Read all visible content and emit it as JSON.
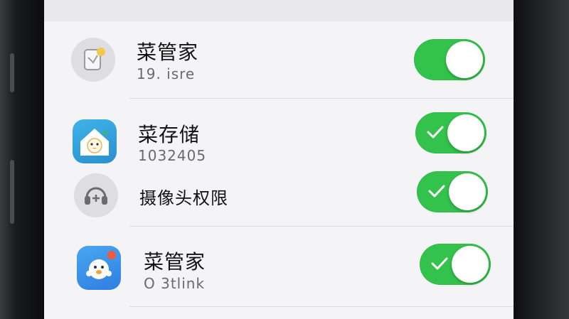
{
  "rows": [
    {
      "title": "菜管家",
      "subtitle": "19. isre",
      "icon": "cleaner-app-icon",
      "toggle_on": true,
      "show_check": false
    },
    {
      "title": "菜存储",
      "subtitle": "1032405",
      "icon": "storage-app-icon",
      "toggle_on": true,
      "show_check": true
    },
    {
      "title": "摄像头权限",
      "subtitle": "",
      "icon": "headset-icon",
      "toggle_on": true,
      "show_check": true
    },
    {
      "title": "菜管家",
      "subtitle": "O 3tlink",
      "icon": "cleaner-mascot-app-icon",
      "toggle_on": true,
      "show_check": true
    }
  ],
  "colors": {
    "toggle_on": "#33c24b",
    "screen_bg": "#f4f4f6",
    "title_text": "#111111",
    "subtitle_text": "#6a6a6e"
  }
}
